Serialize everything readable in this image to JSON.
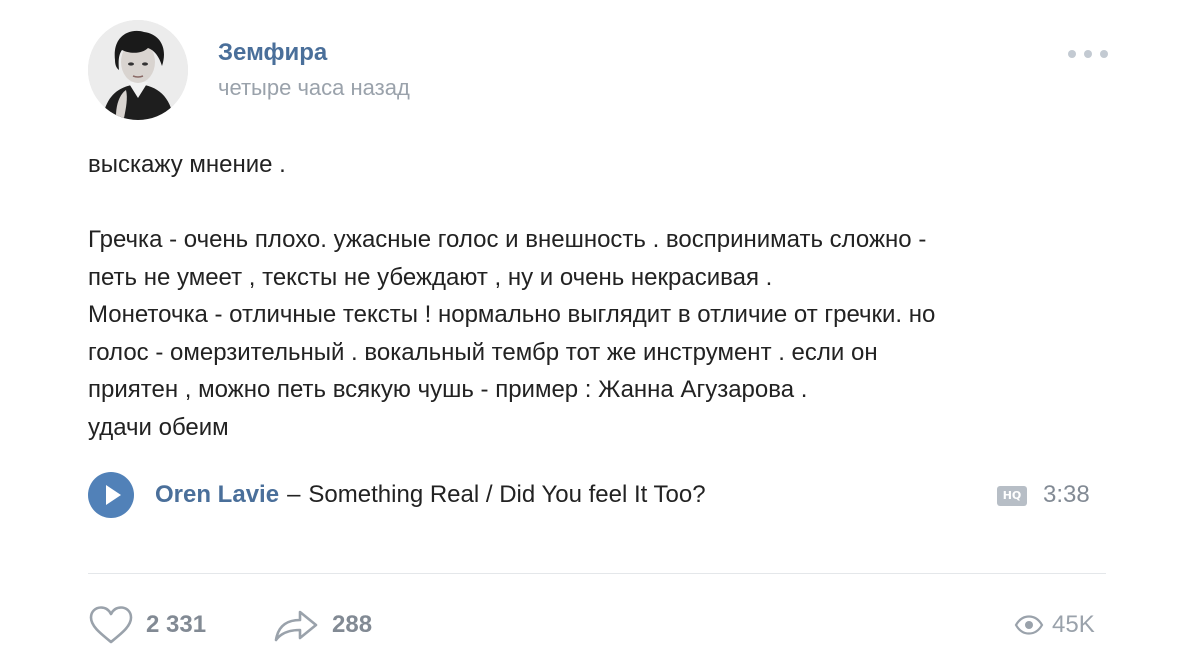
{
  "post": {
    "author": "Земфира",
    "time": "четыре часа назад",
    "text": {
      "lines": [
        "выскажу мнение .",
        "",
        "Гречка - очень плохо. ужасные голос и внешность . воспринимать сложно -",
        "петь не умеет , тексты не убеждают , ну и очень некрасивая .",
        "Монеточка - отличные тексты ! нормально выглядит в отличие от гречки. но",
        "голос - омерзительный . вокальный тембр тот же инструмент . если он",
        "приятен , можно петь всякую чушь - пример : Жанна Агузарова .",
        "удачи обеим"
      ]
    },
    "audio": {
      "artist": "Oren Lavie",
      "dash": "–",
      "title": "Something Real / Did You feel It Too?",
      "quality_badge": "HQ",
      "duration": "3:38"
    },
    "actions": {
      "likes": "2 331",
      "shares": "288",
      "views": "45K"
    }
  },
  "icons": {
    "avatar": "avatar-photo",
    "more": "more-dots-icon",
    "play": "play-icon",
    "like": "heart-icon",
    "share": "share-arrow-icon",
    "views": "eye-icon"
  },
  "colors": {
    "link": "#4a6f9a",
    "accent": "#5181b8",
    "muted": "#828a94",
    "text": "#222222"
  }
}
